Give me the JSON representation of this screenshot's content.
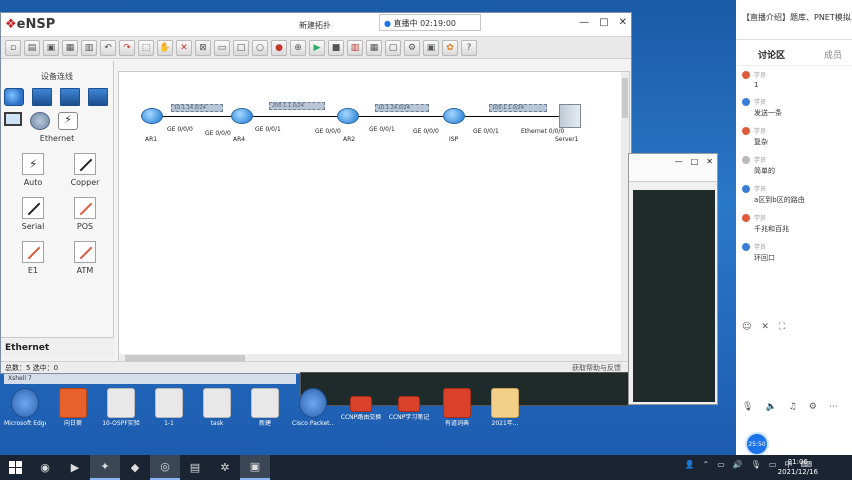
{
  "ensp": {
    "logo": "eNSP",
    "window_title": "新建拓扑",
    "live_badge": "直播中 02:19:00",
    "controls": {
      "min": "—",
      "max": "□",
      "close": "✕"
    },
    "toolbar_icons": [
      "new-icon",
      "open-icon",
      "save-icon",
      "save-as-icon",
      "print-icon",
      "undo-icon",
      "redo-icon",
      "select-icon",
      "hand-icon",
      "delete-icon",
      "delete-all-icon",
      "text-icon",
      "rect-icon",
      "ellipse-icon",
      "palette-icon",
      "link-icon",
      "play-icon",
      "stop-icon",
      "capture-icon",
      "grid-icon",
      "topo-icon",
      "settings-icon",
      "device-icon",
      "huawei-icon",
      "help-icon"
    ],
    "device_panel": {
      "title": "设备连线",
      "ethernet_label": "Ethernet",
      "cables": [
        {
          "label": "Auto",
          "color": "#333333"
        },
        {
          "label": "Copper",
          "color": "#222222"
        },
        {
          "label": "Serial",
          "color": "#222222"
        },
        {
          "label": "POS",
          "color": "#e05a3c"
        },
        {
          "label": "E1",
          "color": "#e05a3c"
        },
        {
          "label": "ATM",
          "color": "#e05a3c"
        }
      ],
      "bottom_label": "Ethernet"
    },
    "topology": {
      "devices": [
        "AR1",
        "AR4",
        "AR2",
        "ISP",
        "Server1"
      ],
      "ports": [
        "GE 0/0/0",
        "GE 0/0/0",
        "GE 0/0/1",
        "GE 0/0/0",
        "GE 0/0/1",
        "GE 0/0/0",
        "GE 0/0/1",
        "Ethernet 0/0/0"
      ],
      "notes": [
        "10.1.14.0/24",
        "200.1.1.0/24",
        "10.1.24.0/24",
        "100.1.1.0/24"
      ]
    },
    "status": {
      "left": "总数：5   选中：0",
      "right": "获取帮助与反馈"
    }
  },
  "chat": {
    "ad": "【直播介绍】题库、PNET模拟...",
    "tabs": {
      "active": "讨论区",
      "inactive": "成员"
    },
    "messages": [
      {
        "user": "学员",
        "text": "1"
      },
      {
        "user": "学员",
        "text": "发送一条"
      },
      {
        "user": "学员",
        "text": "复杂"
      },
      {
        "user": "学员",
        "text": "简单的"
      },
      {
        "user": "学员",
        "text": "a区到b区的路由"
      },
      {
        "user": "学员",
        "text": "千兆和百兆"
      },
      {
        "user": "学员",
        "text": "环回口"
      }
    ],
    "timer": "25:50"
  },
  "desktop": {
    "window_label": "Xshell 7",
    "icons": [
      {
        "label": "Microsoft Edge",
        "kind": "blue"
      },
      {
        "label": "向日葵",
        "kind": "orange"
      },
      {
        "label": "10-OSPF实验",
        "kind": "doc"
      },
      {
        "label": "1-1",
        "kind": "doc"
      },
      {
        "label": "task",
        "kind": "doc"
      },
      {
        "label": "新建",
        "kind": "doc"
      },
      {
        "label": "Cisco Packet...",
        "kind": "blue"
      },
      {
        "label": "CCNP路由交换",
        "kind": "pdf"
      },
      {
        "label": "CCNP学习笔记",
        "kind": "pdf"
      },
      {
        "label": "有道词典",
        "kind": "red"
      },
      {
        "label": "2021年...",
        "kind": "folder"
      }
    ]
  },
  "taskbar": {
    "time": "21:06",
    "date": "2021/12/16",
    "ime": "中"
  }
}
